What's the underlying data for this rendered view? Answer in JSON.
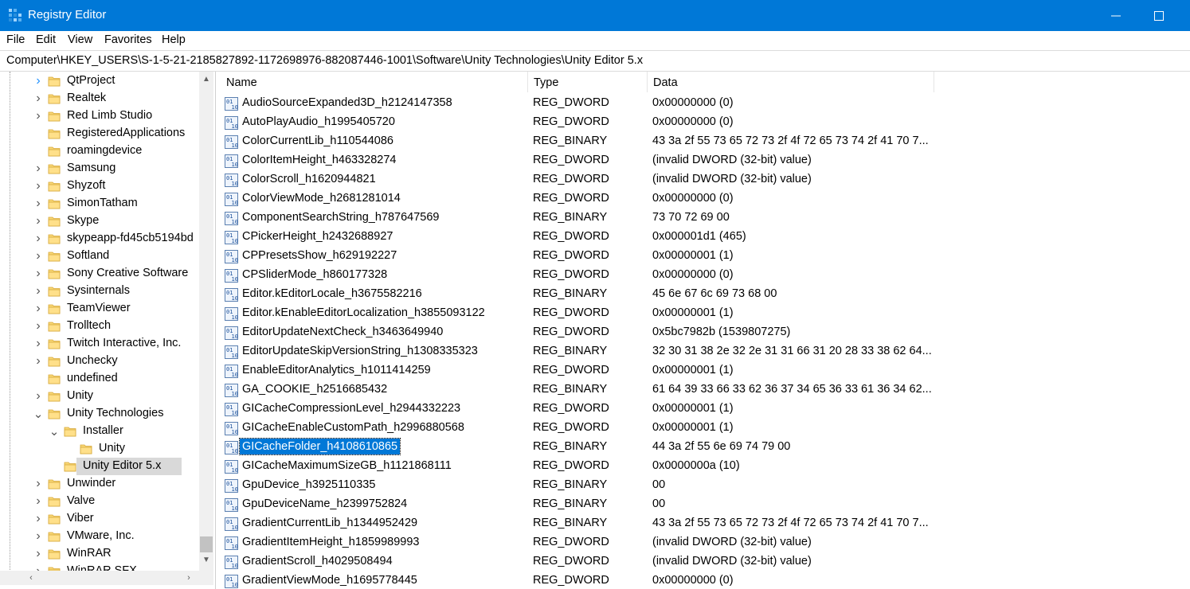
{
  "window": {
    "title": "Registry Editor"
  },
  "menu": [
    "File",
    "Edit",
    "View",
    "Favorites",
    "Help"
  ],
  "address": "Computer\\HKEY_USERS\\S-1-5-21-2185827892-1172698976-882087446-1001\\Software\\Unity Technologies\\Unity Editor 5.x",
  "tree": [
    {
      "label": "QtProject",
      "chevron": "right-hover",
      "indent": 0
    },
    {
      "label": "Realtek",
      "chevron": "right",
      "indent": 0
    },
    {
      "label": "Red Limb Studio",
      "chevron": "right",
      "indent": 0
    },
    {
      "label": "RegisteredApplications",
      "chevron": "none",
      "indent": 0
    },
    {
      "label": "roamingdevice",
      "chevron": "none",
      "indent": 0
    },
    {
      "label": "Samsung",
      "chevron": "right",
      "indent": 0
    },
    {
      "label": "Shyzoft",
      "chevron": "right",
      "indent": 0
    },
    {
      "label": "SimonTatham",
      "chevron": "right",
      "indent": 0
    },
    {
      "label": "Skype",
      "chevron": "right",
      "indent": 0
    },
    {
      "label": "skypeapp-fd45cb5194bd",
      "chevron": "right",
      "indent": 0
    },
    {
      "label": "Softland",
      "chevron": "right",
      "indent": 0
    },
    {
      "label": "Sony Creative Software",
      "chevron": "right",
      "indent": 0
    },
    {
      "label": "Sysinternals",
      "chevron": "right",
      "indent": 0
    },
    {
      "label": "TeamViewer",
      "chevron": "right",
      "indent": 0
    },
    {
      "label": "Trolltech",
      "chevron": "right",
      "indent": 0
    },
    {
      "label": "Twitch Interactive, Inc.",
      "chevron": "right",
      "indent": 0
    },
    {
      "label": "Unchecky",
      "chevron": "right",
      "indent": 0
    },
    {
      "label": "undefined",
      "chevron": "none",
      "indent": 0
    },
    {
      "label": "Unity",
      "chevron": "right",
      "indent": 0
    },
    {
      "label": "Unity Technologies",
      "chevron": "down",
      "indent": 0
    },
    {
      "label": "Installer",
      "chevron": "down",
      "indent": 1
    },
    {
      "label": "Unity",
      "chevron": "none",
      "indent": 2
    },
    {
      "label": "Unity Editor 5.x",
      "chevron": "none",
      "indent": 1,
      "selected": true
    },
    {
      "label": "Unwinder",
      "chevron": "right",
      "indent": 0
    },
    {
      "label": "Valve",
      "chevron": "right",
      "indent": 0
    },
    {
      "label": "Viber",
      "chevron": "right",
      "indent": 0
    },
    {
      "label": "VMware, Inc.",
      "chevron": "right",
      "indent": 0
    },
    {
      "label": "WinRAR",
      "chevron": "right",
      "indent": 0
    },
    {
      "label": "WinRAR SFX",
      "chevron": "right",
      "indent": 0
    }
  ],
  "columns": {
    "name": "Name",
    "type": "Type",
    "data": "Data"
  },
  "values": [
    {
      "name": "AudioSourceExpanded3D_h2124147358",
      "type": "REG_DWORD",
      "data": "0x00000000 (0)"
    },
    {
      "name": "AutoPlayAudio_h1995405720",
      "type": "REG_DWORD",
      "data": "0x00000000 (0)"
    },
    {
      "name": "ColorCurrentLib_h110544086",
      "type": "REG_BINARY",
      "data": "43 3a 2f 55 73 65 72 73 2f 4f 72 65 73 74 2f 41 70 7..."
    },
    {
      "name": "ColorItemHeight_h463328274",
      "type": "REG_DWORD",
      "data": "(invalid DWORD (32-bit) value)"
    },
    {
      "name": "ColorScroll_h1620944821",
      "type": "REG_DWORD",
      "data": "(invalid DWORD (32-bit) value)"
    },
    {
      "name": "ColorViewMode_h2681281014",
      "type": "REG_DWORD",
      "data": "0x00000000 (0)"
    },
    {
      "name": "ComponentSearchString_h787647569",
      "type": "REG_BINARY",
      "data": "73 70 72 69 00"
    },
    {
      "name": "CPickerHeight_h2432688927",
      "type": "REG_DWORD",
      "data": "0x000001d1 (465)"
    },
    {
      "name": "CPPresetsShow_h629192227",
      "type": "REG_DWORD",
      "data": "0x00000001 (1)"
    },
    {
      "name": "CPSliderMode_h860177328",
      "type": "REG_DWORD",
      "data": "0x00000000 (0)"
    },
    {
      "name": "Editor.kEditorLocale_h3675582216",
      "type": "REG_BINARY",
      "data": "45 6e 67 6c 69 73 68 00"
    },
    {
      "name": "Editor.kEnableEditorLocalization_h3855093122",
      "type": "REG_DWORD",
      "data": "0x00000001 (1)"
    },
    {
      "name": "EditorUpdateNextCheck_h3463649940",
      "type": "REG_DWORD",
      "data": "0x5bc7982b (1539807275)"
    },
    {
      "name": "EditorUpdateSkipVersionString_h1308335323",
      "type": "REG_BINARY",
      "data": "32 30 31 38 2e 32 2e 31 31 66 31 20 28 33 38 62 64..."
    },
    {
      "name": "EnableEditorAnalytics_h1011414259",
      "type": "REG_DWORD",
      "data": "0x00000001 (1)"
    },
    {
      "name": "GA_COOKIE_h2516685432",
      "type": "REG_BINARY",
      "data": "61 64 39 33 66 33 62 36 37 34 65 36 33 61 36 34 62..."
    },
    {
      "name": "GICacheCompressionLevel_h2944332223",
      "type": "REG_DWORD",
      "data": "0x00000001 (1)"
    },
    {
      "name": "GICacheEnableCustomPath_h2996880568",
      "type": "REG_DWORD",
      "data": "0x00000001 (1)"
    },
    {
      "name": "GICacheFolder_h4108610865",
      "type": "REG_BINARY",
      "data": "44 3a 2f 55 6e 69 74 79 00",
      "selected": true
    },
    {
      "name": "GICacheMaximumSizeGB_h1121868111",
      "type": "REG_DWORD",
      "data": "0x0000000a (10)"
    },
    {
      "name": "GpuDevice_h3925110335",
      "type": "REG_BINARY",
      "data": "00"
    },
    {
      "name": "GpuDeviceName_h2399752824",
      "type": "REG_BINARY",
      "data": "00"
    },
    {
      "name": "GradientCurrentLib_h1344952429",
      "type": "REG_BINARY",
      "data": "43 3a 2f 55 73 65 72 73 2f 4f 72 65 73 74 2f 41 70 7..."
    },
    {
      "name": "GradientItemHeight_h1859989993",
      "type": "REG_DWORD",
      "data": "(invalid DWORD (32-bit) value)"
    },
    {
      "name": "GradientScroll_h4029508494",
      "type": "REG_DWORD",
      "data": "(invalid DWORD (32-bit) value)"
    },
    {
      "name": "GradientViewMode_h1695778445",
      "type": "REG_DWORD",
      "data": "0x00000000 (0)"
    }
  ],
  "colors": {
    "titlebar": "#0078d7",
    "selection": "#0078d7",
    "tree_selection": "#d9d9d9",
    "folder": "#f8d775"
  },
  "icons": {
    "app": "registry-editor-icon",
    "folder": "folder-icon",
    "value": "binary-value-icon"
  }
}
